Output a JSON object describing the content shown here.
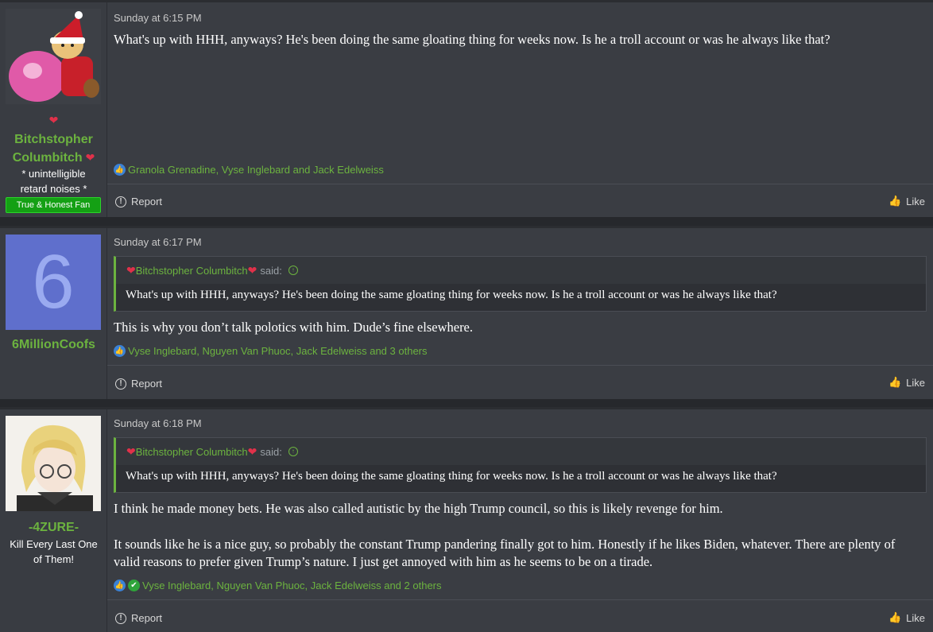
{
  "posts": [
    {
      "user": {
        "name_line1": "Bitchstopher",
        "name_line2": "Columbitch",
        "title_line1": "* unintelligible",
        "title_line2": "retard noises *",
        "banner": "True & Honest Fan"
      },
      "time": "Sunday at 6:15 PM",
      "message": [
        "What's up with HHH, anyways? He's been doing the same gloating thing for weeks now. Is he a troll account or was he always like that?"
      ],
      "reactions": "Granola Grenadine, Vyse Inglebard and Jack Edelweiss",
      "report": "Report",
      "like": "Like"
    },
    {
      "user": {
        "name": "6MillionCoofs",
        "avatar_letter": "6"
      },
      "time": "Sunday at 6:17 PM",
      "quote": {
        "author": "Bitchstopher Columbitch",
        "said": "said:",
        "text": "What's up with HHH, anyways? He's been doing the same gloating thing for weeks now. Is he a troll account or was he always like that?"
      },
      "message": [
        "This is why you don’t talk polotics with him. Dude’s fine elsewhere."
      ],
      "reactions": "Vyse Inglebard, Nguyen Van Phuoc, Jack Edelweiss and 3 others",
      "report": "Report",
      "like": "Like"
    },
    {
      "user": {
        "name": "-4ZURE-",
        "title_line1": "Kill Every Last One",
        "title_line2": "of Them!"
      },
      "time": "Sunday at 6:18 PM",
      "quote": {
        "author": "Bitchstopher Columbitch",
        "said": "said:",
        "text": "What's up with HHH, anyways? He's been doing the same gloating thing for weeks now. Is he a troll account or was he always like that?"
      },
      "message": [
        "I think he made money bets. He was also called autistic by the high Trump council, so this is likely revenge for him.",
        "It sounds like he is a nice guy, so probably the constant Trump pandering finally got to him. Honestly if he likes Biden, whatever. There are plenty of valid reasons to prefer given Trump’s nature. I just get annoyed with him as he seems to be on a tirade."
      ],
      "reactions": "Vyse Inglebard, Nguyen Van Phuoc, Jack Edelweiss and 2 others",
      "report": "Report",
      "like": "Like"
    }
  ],
  "colors": {
    "username": "#6cb33f",
    "heart": "#e0314a",
    "banner": "#14a014",
    "avatar_bg": "#5f6fcc"
  }
}
